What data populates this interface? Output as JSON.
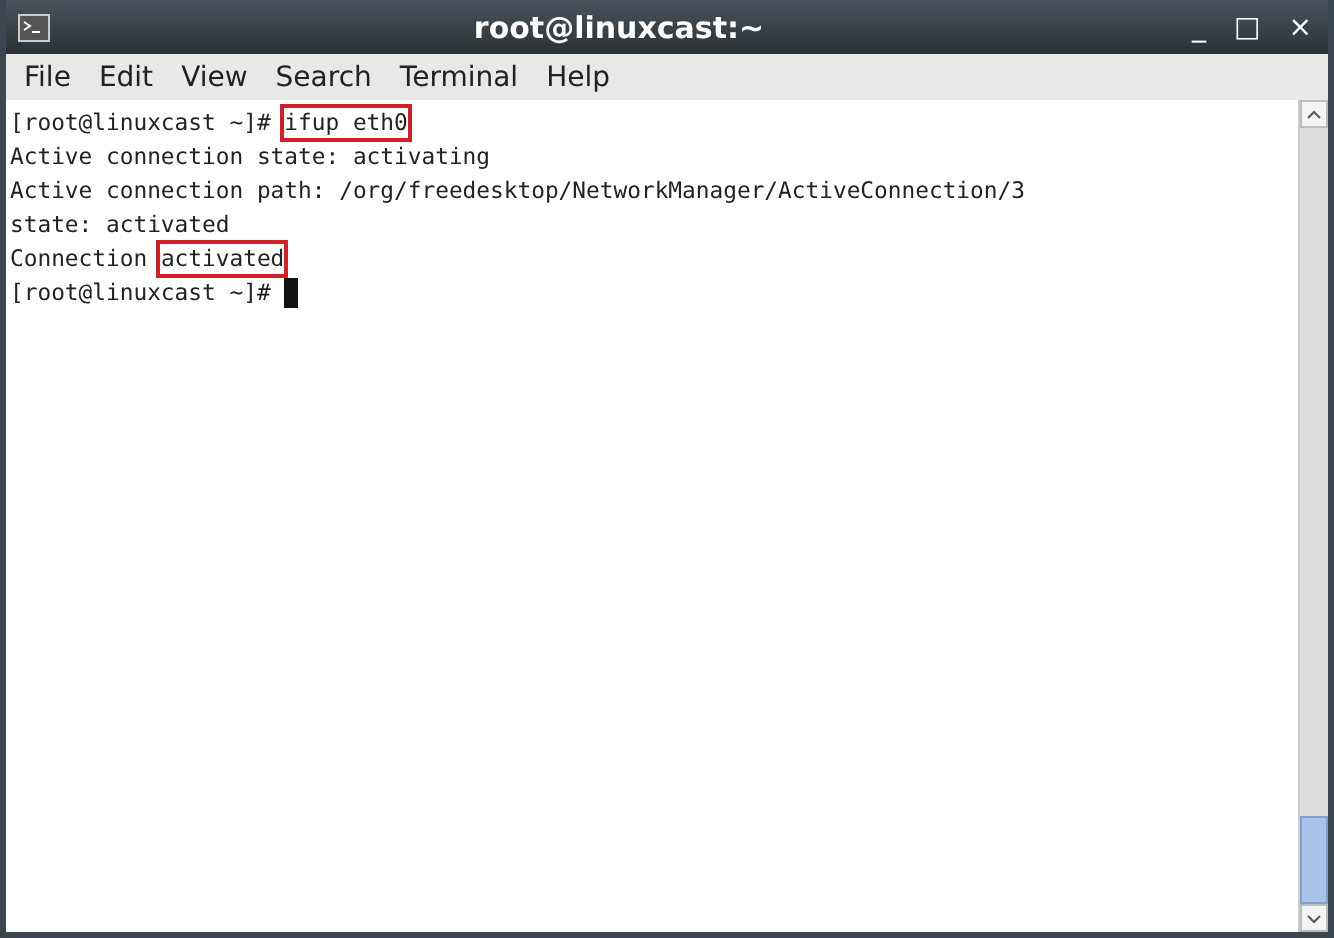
{
  "window": {
    "title": "root@linuxcast:~",
    "controls": [
      "_",
      "□",
      "×"
    ]
  },
  "menu": [
    "File",
    "Edit",
    "View",
    "Search",
    "Terminal",
    "Help"
  ],
  "terminal": {
    "lines": [
      [
        {
          "text": "[root@linuxcast ~]# ",
          "highlighted": false
        },
        {
          "text": "ifup eth0",
          "highlighted": true
        }
      ],
      [
        {
          "text": "Active connection state: activating",
          "highlighted": false
        }
      ],
      [
        {
          "text": "Active connection path: /org/freedesktop/NetworkManager/ActiveConnection/3",
          "highlighted": false
        }
      ],
      [
        {
          "text": "state: activated",
          "highlighted": false
        }
      ],
      [
        {
          "text": "Connection ",
          "highlighted": false
        },
        {
          "text": "activated",
          "highlighted": true
        }
      ],
      [
        {
          "text": "[root@linuxcast ~]# ",
          "highlighted": false
        }
      ]
    ],
    "cursor": true
  }
}
